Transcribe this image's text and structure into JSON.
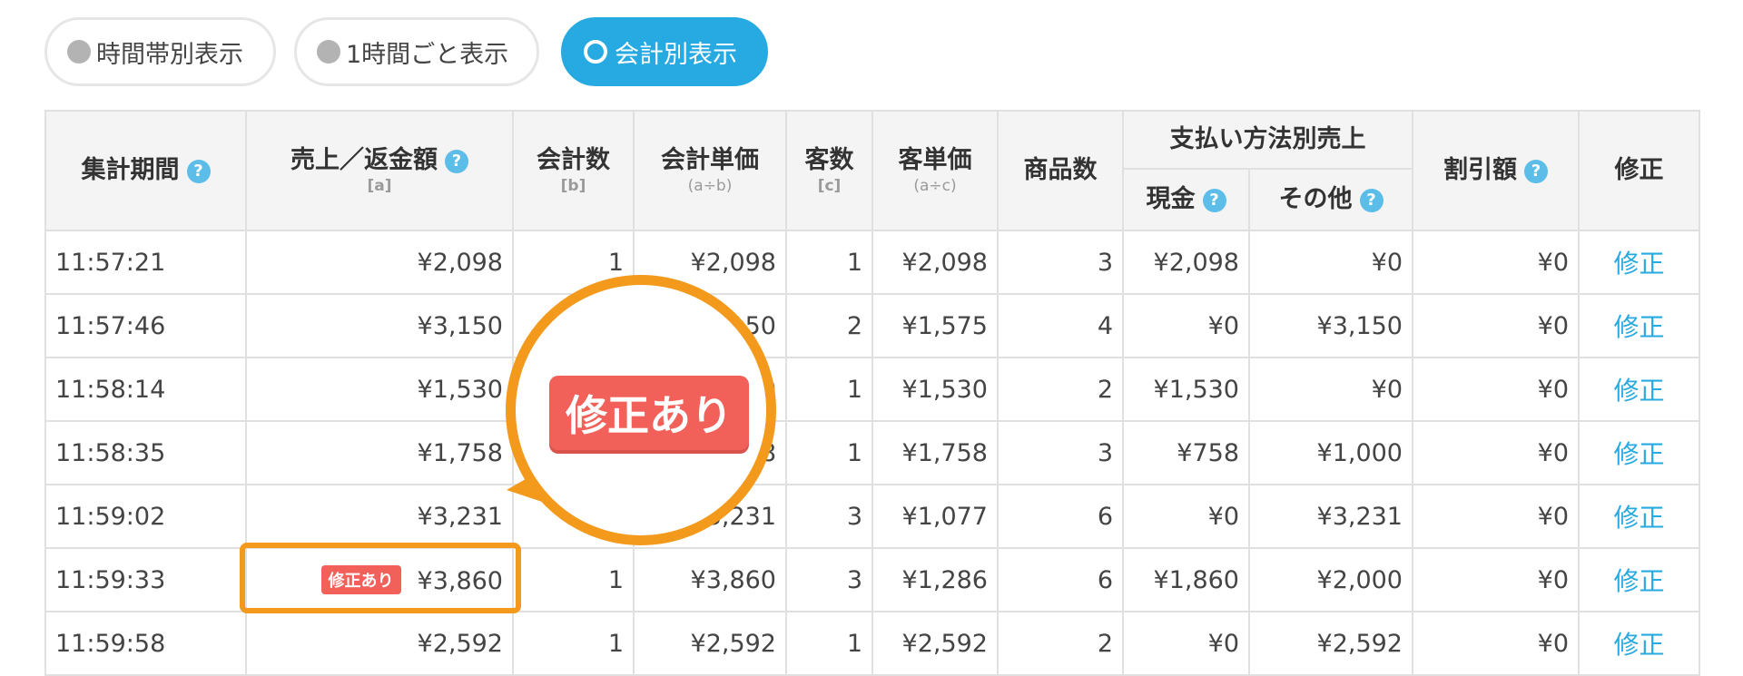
{
  "toggles": [
    {
      "label": "時間帯別表示",
      "active": false
    },
    {
      "label": "1時間ごと表示",
      "active": false
    },
    {
      "label": "会計別表示",
      "active": true
    }
  ],
  "headers": {
    "period": "集計期間",
    "sales": "売上／返金額",
    "sales_sub": "[a]",
    "count": "会計数",
    "count_sub": "[b]",
    "unit_price": "会計単価",
    "unit_price_sub": "(a÷b)",
    "customers": "客数",
    "customers_sub": "[c]",
    "customer_price": "客単価",
    "customer_price_sub": "(a÷c)",
    "items": "商品数",
    "payment_group": "支払い方法別売上",
    "cash": "現金",
    "other": "その他",
    "discount": "割引額",
    "fix": "修正"
  },
  "help_glyph": "?",
  "rows": [
    {
      "time": "11:57:21",
      "sales": "¥2,098",
      "count": "1",
      "unit": "¥2,098",
      "customers": "1",
      "cust_price": "¥2,098",
      "items": "3",
      "cash": "¥2,098",
      "other": "¥0",
      "discount": "¥0",
      "fix": "修正",
      "badge": ""
    },
    {
      "time": "11:57:46",
      "sales": "¥3,150",
      "count": "",
      "unit": "150",
      "customers": "2",
      "cust_price": "¥1,575",
      "items": "4",
      "cash": "¥0",
      "other": "¥3,150",
      "discount": "¥0",
      "fix": "修正",
      "badge": ""
    },
    {
      "time": "11:58:14",
      "sales": "¥1,530",
      "count": "",
      "unit": "0",
      "customers": "1",
      "cust_price": "¥1,530",
      "items": "2",
      "cash": "¥1,530",
      "other": "¥0",
      "discount": "¥0",
      "fix": "修正",
      "badge": ""
    },
    {
      "time": "11:58:35",
      "sales": "¥1,758",
      "count": "",
      "unit": "8",
      "customers": "1",
      "cust_price": "¥1,758",
      "items": "3",
      "cash": "¥758",
      "other": "¥1,000",
      "discount": "¥0",
      "fix": "修正",
      "badge": ""
    },
    {
      "time": "11:59:02",
      "sales": "¥3,231",
      "count": "",
      "unit": "3,231",
      "customers": "3",
      "cust_price": "¥1,077",
      "items": "6",
      "cash": "¥0",
      "other": "¥3,231",
      "discount": "¥0",
      "fix": "修正",
      "badge": ""
    },
    {
      "time": "11:59:33",
      "sales": "¥3,860",
      "count": "1",
      "unit": "¥3,860",
      "customers": "3",
      "cust_price": "¥1,286",
      "items": "6",
      "cash": "¥1,860",
      "other": "¥2,000",
      "discount": "¥0",
      "fix": "修正",
      "badge": "修正あり"
    },
    {
      "time": "11:59:58",
      "sales": "¥2,592",
      "count": "1",
      "unit": "¥2,592",
      "customers": "1",
      "cust_price": "¥2,592",
      "items": "2",
      "cash": "¥0",
      "other": "¥2,592",
      "discount": "¥0",
      "fix": "修正",
      "badge": ""
    }
  ],
  "callout": {
    "label": "修正あり"
  },
  "colors": {
    "accent": "#27a9e1",
    "badge": "#f2605a",
    "highlight": "#f39a1c"
  }
}
